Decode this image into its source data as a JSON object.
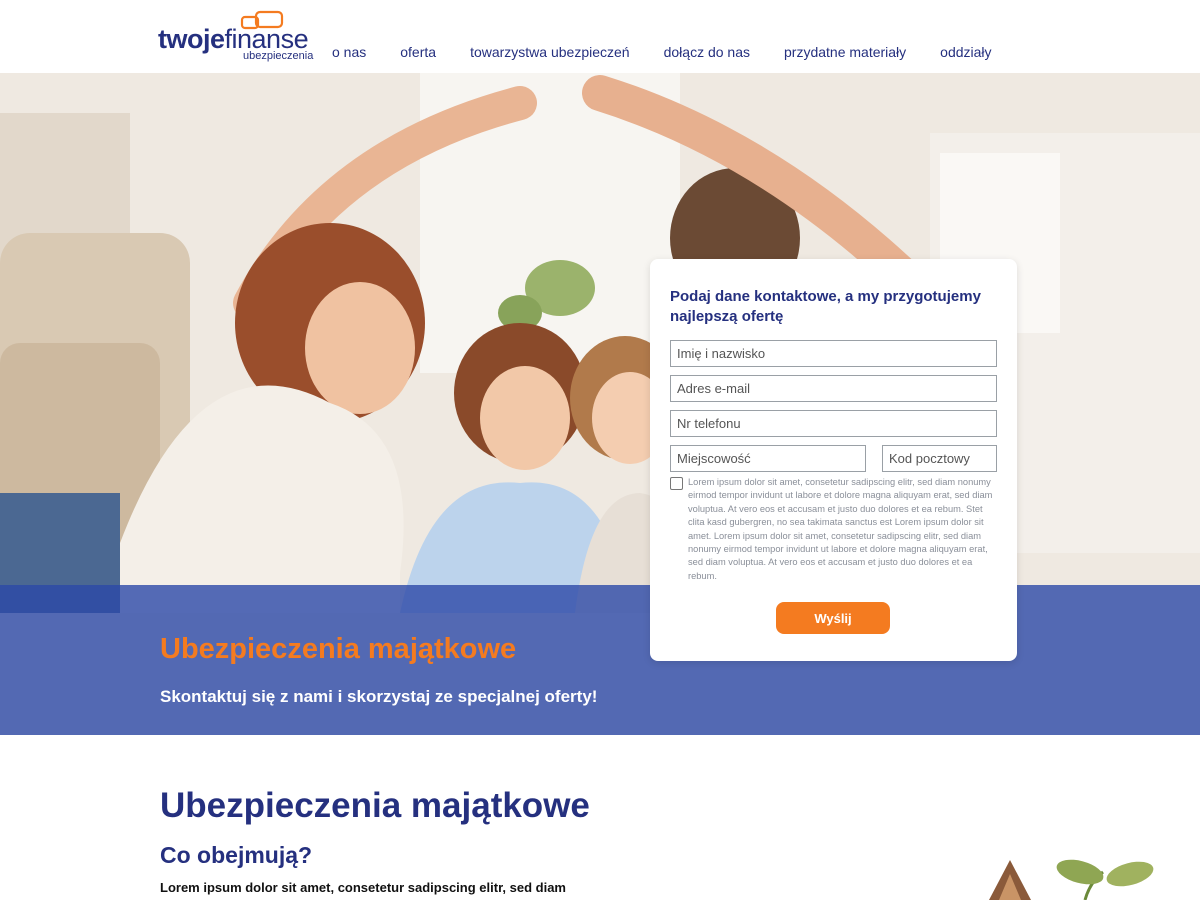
{
  "header": {
    "logo": {
      "word_bold": "twoje",
      "word_light": "finanse",
      "subtitle": "ubezpieczenia",
      "accent_color": "#f47b20",
      "brand_color": "#25307f"
    },
    "nav": [
      {
        "label": "o nas"
      },
      {
        "label": "oferta"
      },
      {
        "label": "towarzystwa ubezpieczeń"
      },
      {
        "label": "dołącz do nas"
      },
      {
        "label": "przydatne materiały"
      },
      {
        "label": "oddziały"
      }
    ]
  },
  "hero": {
    "title": "Ubezpieczenia majątkowe",
    "subtitle": "Skontaktuj się z nami i skorzystaj ze specjalnej oferty!",
    "band_color": "#2c48a8"
  },
  "form": {
    "title": "Podaj dane kontaktowe, a my przygotujemy najlepszą ofertę",
    "fields": {
      "name": {
        "placeholder": "Imię i nazwisko"
      },
      "email": {
        "placeholder": "Adres e-mail"
      },
      "phone": {
        "placeholder": "Nr telefonu"
      },
      "city": {
        "placeholder": "Miejscowość"
      },
      "zip": {
        "placeholder": "Kod pocztowy"
      }
    },
    "consent": "Lorem ipsum dolor sit amet, consetetur sadipscing elitr, sed diam nonumy eirmod tempor invidunt ut labore et dolore magna aliquyam erat, sed diam voluptua. At vero eos et accusam et justo duo dolores et ea rebum. Stet clita kasd gubergren, no sea takimata sanctus est Lorem ipsum dolor sit amet. Lorem ipsum dolor sit amet, consetetur sadipscing elitr, sed diam nonumy eirmod tempor invidunt ut labore et dolore magna aliquyam erat, sed diam voluptua. At vero eos et accusam et justo duo dolores et ea rebum.",
    "consent_checked": false,
    "submit_label": "Wyślij"
  },
  "content": {
    "title": "Ubezpieczenia majątkowe",
    "subtitle": "Co obejmują?",
    "text": "Lorem ipsum dolor sit amet, consetetur sadipscing elitr, sed diam"
  }
}
